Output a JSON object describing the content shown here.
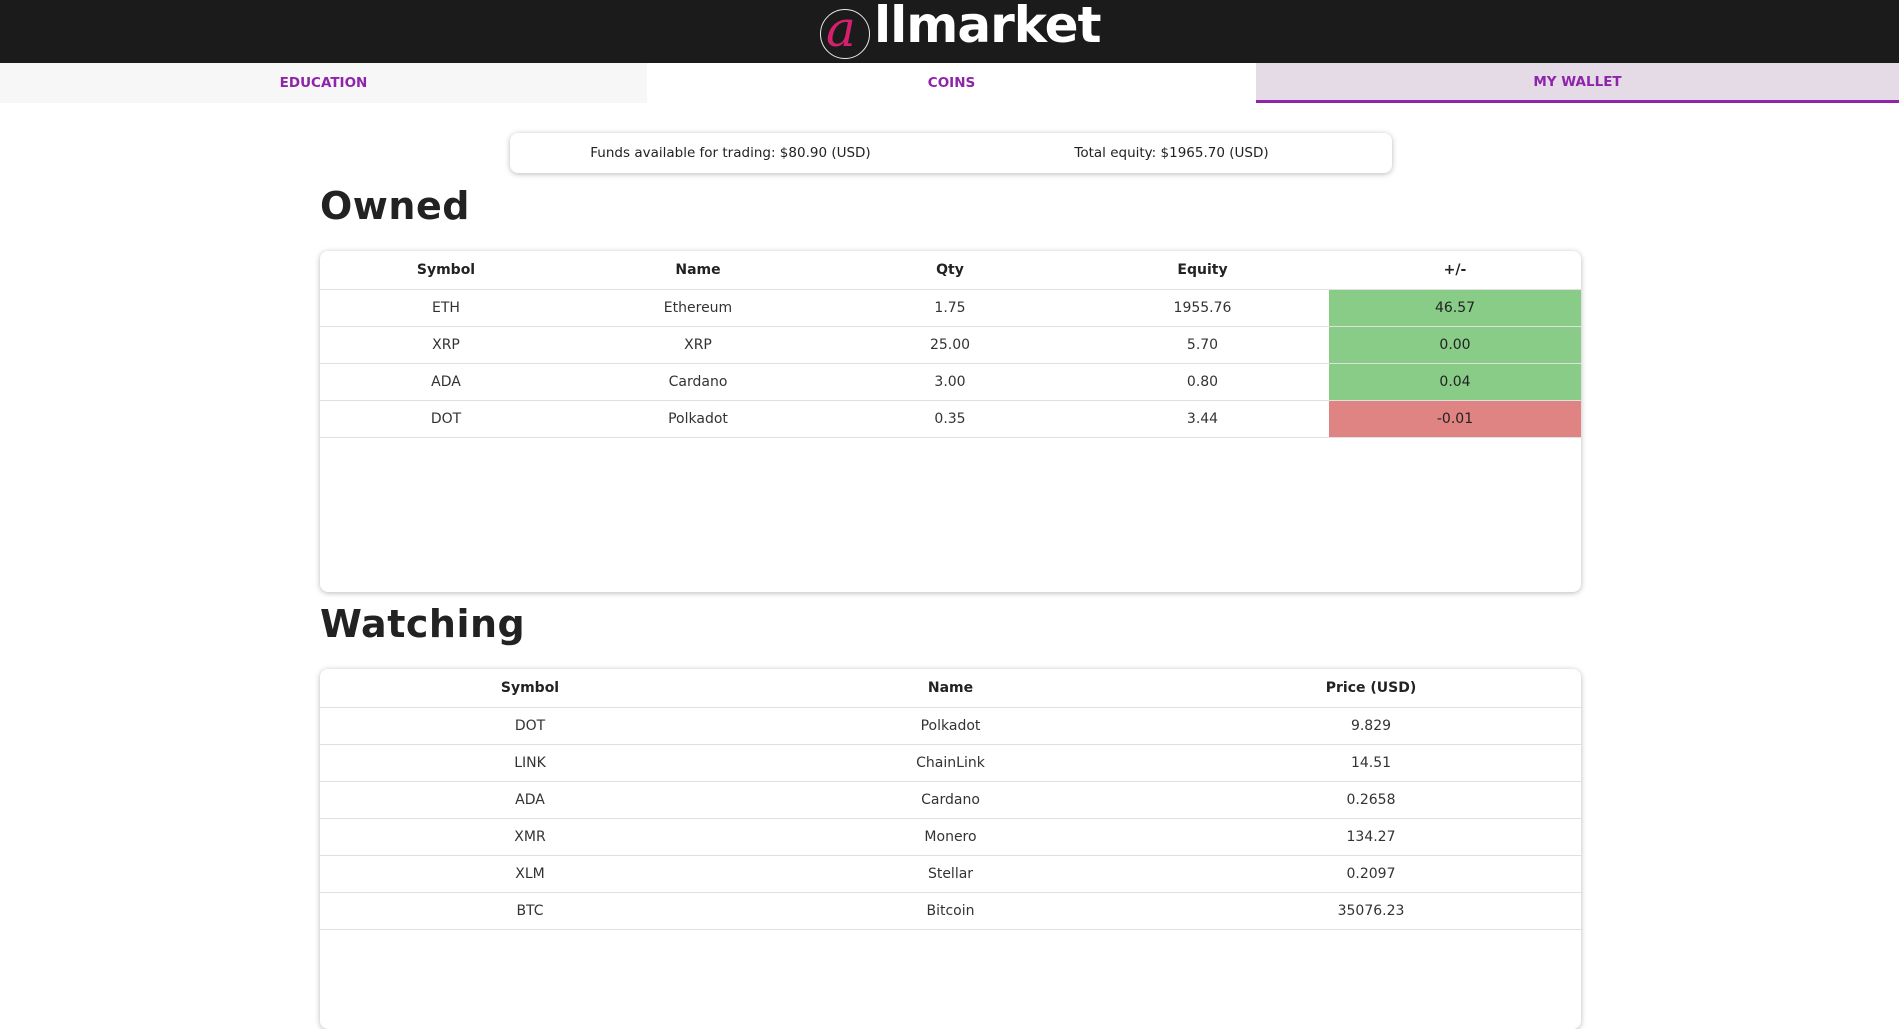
{
  "header": {
    "logo_letter": "a",
    "logo_text": "llmarket"
  },
  "tabs": [
    {
      "label": "EDUCATION"
    },
    {
      "label": "COINS"
    },
    {
      "label": "MY WALLET"
    }
  ],
  "summary": {
    "funds": "Funds available for trading: $80.90 (USD)",
    "equity": "Total equity: $1965.70 (USD)"
  },
  "owned": {
    "title": "Owned",
    "columns": [
      "Symbol",
      "Name",
      "Qty",
      "Equity",
      "+/-"
    ],
    "rows": [
      {
        "symbol": "ETH",
        "name": "Ethereum",
        "qty": "1.75",
        "equity": "1955.76",
        "change": "46.57",
        "status": "pos"
      },
      {
        "symbol": "XRP",
        "name": "XRP",
        "qty": "25.00",
        "equity": "5.70",
        "change": "0.00",
        "status": "pos"
      },
      {
        "symbol": "ADA",
        "name": "Cardano",
        "qty": "3.00",
        "equity": "0.80",
        "change": "0.04",
        "status": "pos"
      },
      {
        "symbol": "DOT",
        "name": "Polkadot",
        "qty": "0.35",
        "equity": "3.44",
        "change": "-0.01",
        "status": "neg"
      }
    ]
  },
  "watching": {
    "title": "Watching",
    "columns": [
      "Symbol",
      "Name",
      "Price (USD)"
    ],
    "rows": [
      {
        "symbol": "DOT",
        "name": "Polkadot",
        "price": "9.829"
      },
      {
        "symbol": "LINK",
        "name": "ChainLink",
        "price": "14.51"
      },
      {
        "symbol": "ADA",
        "name": "Cardano",
        "price": "0.2658"
      },
      {
        "symbol": "XMR",
        "name": "Monero",
        "price": "134.27"
      },
      {
        "symbol": "XLM",
        "name": "Stellar",
        "price": "0.2097"
      },
      {
        "symbol": "BTC",
        "name": "Bitcoin",
        "price": "35076.23"
      }
    ]
  },
  "colors": {
    "header_bg": "#1b1b1b",
    "accent": "#8e24aa",
    "positive": "#88cc88",
    "negative": "#e08383",
    "logo_accent": "#d5206e"
  }
}
